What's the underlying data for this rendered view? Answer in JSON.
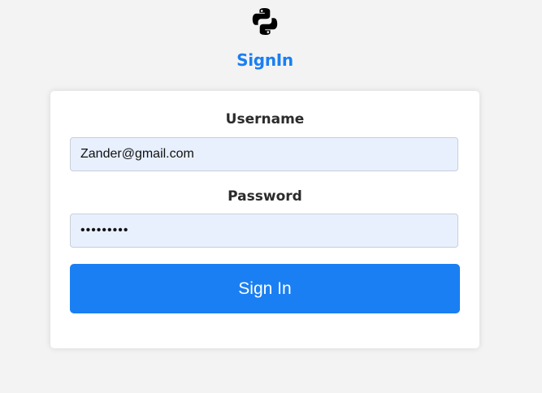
{
  "header": {
    "logo_icon": "python-logo-icon",
    "title": "SignIn"
  },
  "form": {
    "username_label": "Username",
    "username_value": "Zander@gmail.com",
    "password_label": "Password",
    "password_value": "passwords",
    "submit_label": "Sign In"
  },
  "colors": {
    "accent": "#1a7ff2",
    "input_bg": "#e8f0fe",
    "page_bg": "#f3f3f3",
    "card_bg": "#ffffff"
  }
}
